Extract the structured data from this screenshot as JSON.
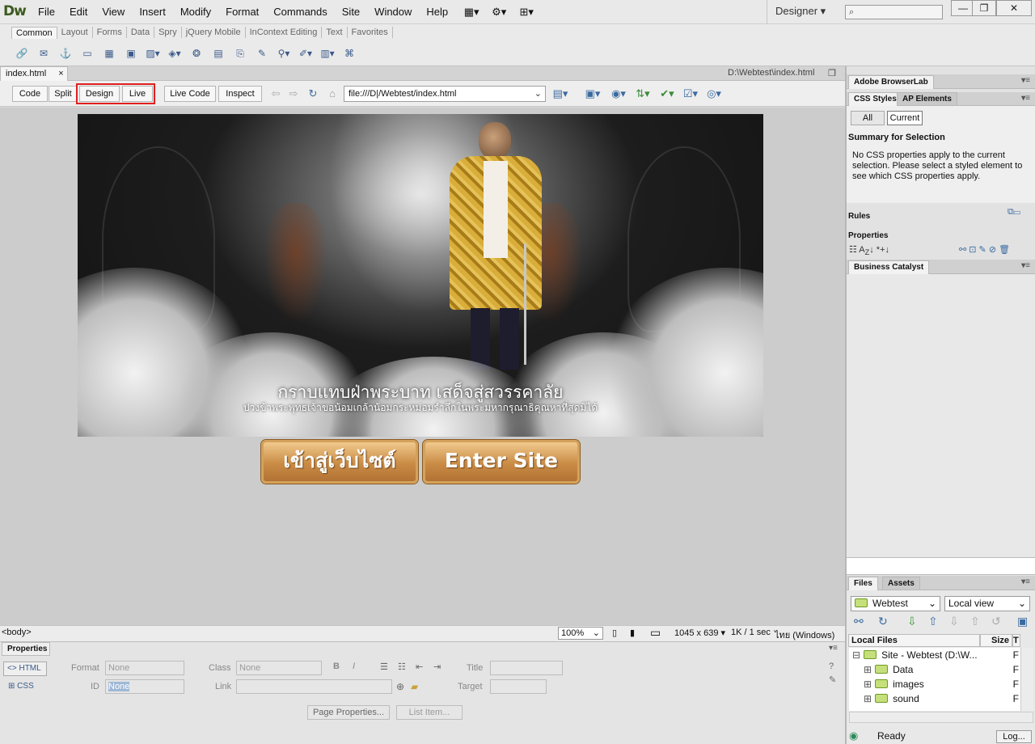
{
  "app": {
    "logo": "Dw",
    "menus": [
      "File",
      "Edit",
      "View",
      "Insert",
      "Modify",
      "Format",
      "Commands",
      "Site",
      "Window",
      "Help"
    ],
    "workspace": "Designer",
    "workspace_arrow": "▾"
  },
  "insert": {
    "tabs": [
      "Common",
      "Layout",
      "Forms",
      "Data",
      "Spry",
      "jQuery Mobile",
      "InContext Editing",
      "Text",
      "Favorites"
    ]
  },
  "doc": {
    "tab_label": "index.html",
    "close": "×",
    "path": "D:\\Webtest\\index.html"
  },
  "toolbar": {
    "code": "Code",
    "split": "Split",
    "design": "Design",
    "live": "Live",
    "live_code": "Live Code",
    "inspect": "Inspect",
    "url": "file:///D|/Webtest/index.html"
  },
  "page": {
    "banner_title": "กราบแทบฝ่าพระบาท เสด็จสู่สวรรคาลัย",
    "banner_subtitle": "ปวงข้าพระพุทธเจ้าขอน้อมเกล้าน้อมกระหม่อมรำลึกในพระมหากรุณาธิคุณหาที่สุดมิได้",
    "button_thai": "เข้าสู่เว็บไซต์",
    "button_en": "Enter Site"
  },
  "status": {
    "tag": "<body>",
    "zoom": "100%",
    "dimensions": "1045 x 639",
    "size_time": "1K / 1 sec",
    "encoding": "ไทย (Windows)"
  },
  "properties": {
    "tab": "Properties",
    "html": "HTML",
    "css": "CSS",
    "format_label": "Format",
    "format_value": "None",
    "class_label": "Class",
    "class_value": "None",
    "id_label": "ID",
    "id_value": "None",
    "link_label": "Link",
    "title_label": "Title",
    "target_label": "Target",
    "page_properties": "Page Properties...",
    "list_item": "List Item..."
  },
  "panels": {
    "browserlab": "Adobe BrowserLab",
    "css_styles": "CSS Styles",
    "ap_elements": "AP Elements",
    "all": "All",
    "current": "Current",
    "summary_title": "Summary for Selection",
    "summary_text": "No CSS properties apply to the current selection.  Please select a styled element to see which CSS properties apply.",
    "rules": "Rules",
    "properties": "Properties",
    "business_catalyst": "Business Catalyst",
    "files": "Files",
    "assets": "Assets",
    "site_select": "Webtest",
    "view_select": "Local view",
    "local_files": "Local Files",
    "size": "Size",
    "size_col2": "T",
    "tree": [
      {
        "label": "Site - Webtest (D:\\W...",
        "type": "F"
      },
      {
        "label": "Data",
        "type": "F"
      },
      {
        "label": "images",
        "type": "F"
      },
      {
        "label": "sound",
        "type": "F"
      }
    ],
    "ready": "Ready",
    "log": "Log..."
  }
}
